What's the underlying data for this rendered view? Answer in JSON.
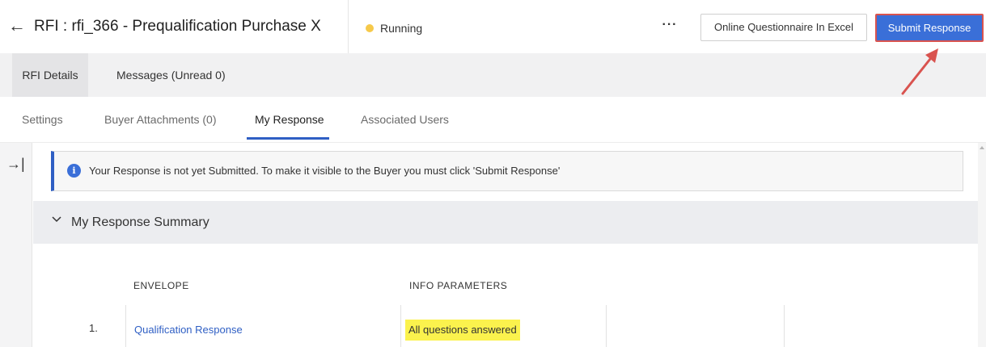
{
  "header": {
    "back_icon": "back-arrow-icon",
    "title": "RFI : rfi_366 - Prequalification Purchase X",
    "status": {
      "label": "Running",
      "color": "#f6c94a"
    },
    "more_label": "···",
    "excel_label": "Online Questionnaire In Excel",
    "submit_label": "Submit Response"
  },
  "primary_tabs": [
    {
      "label": "RFI Details",
      "active": true
    },
    {
      "label": "Messages (Unread 0)",
      "active": false
    }
  ],
  "sub_tabs": [
    {
      "label": "Settings",
      "active": false
    },
    {
      "label": "Buyer Attachments (0)",
      "active": false
    },
    {
      "label": "My Response",
      "active": true
    },
    {
      "label": "Associated Users",
      "active": false
    }
  ],
  "sidebar": {
    "collapse_icon": "expand-panel-icon",
    "collapse_glyph": "→|"
  },
  "banner": {
    "icon": "info-icon",
    "icon_glyph": "i",
    "text": "Your Response is not yet Submitted. To make it visible to the Buyer you must click 'Submit Response'"
  },
  "summary": {
    "title": "My Response Summary",
    "expanded": true,
    "columns": [
      "ENVELOPE",
      "INFO PARAMETERS"
    ],
    "rows": [
      {
        "index": "1.",
        "envelope": "Qualification Response",
        "info": "All questions answered"
      }
    ]
  },
  "colors": {
    "accent": "#3a6fd8",
    "annotation": "#d9534f",
    "highlight": "#fbf24d"
  }
}
